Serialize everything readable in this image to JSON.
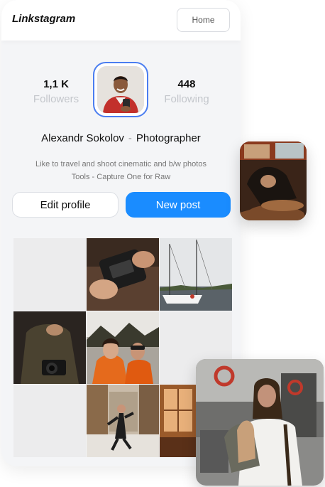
{
  "header": {
    "logo": "Linkstagram",
    "home_label": "Home"
  },
  "profile": {
    "followers_count": "1,1 K",
    "followers_label": "Followers",
    "following_count": "448",
    "following_label": "Following",
    "name": "Alexandr Sokolov",
    "separator": "-",
    "role": "Photographer",
    "bio_line1": "Like to travel and shoot cinematic and b/w photos",
    "bio_line2": "Tools - Capture One for Raw"
  },
  "actions": {
    "edit_label": "Edit profile",
    "new_post_label": "New post"
  },
  "colors": {
    "accent": "#1a8cff",
    "avatar_ring": "#4a7df0"
  },
  "grid": {
    "tiles": [
      "empty",
      "camera-hands",
      "sailboats",
      "man-camera",
      "friends-selfie",
      "empty",
      "empty",
      "street-dance",
      "window-light"
    ]
  }
}
